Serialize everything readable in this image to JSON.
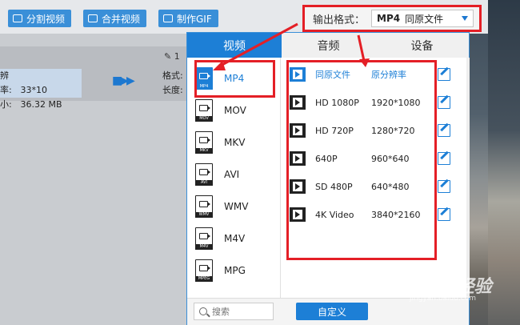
{
  "toolbar": {
    "split_label": "分割视频",
    "merge_label": "合并视频",
    "gif_label": "制作GIF"
  },
  "file_row": {
    "edit_tag": "1",
    "resolution_key": "辨率:",
    "resolution_val": "33*10",
    "size_key": "小:",
    "size_val": "36.32 MB",
    "format_key": "格式:",
    "length_key": "长度:"
  },
  "output_format": {
    "label": "输出格式：",
    "format": "MP4",
    "option": "同原文件"
  },
  "tabs": [
    {
      "label": "视频",
      "active": true
    },
    {
      "label": "音频",
      "active": false
    },
    {
      "label": "设备",
      "active": false
    }
  ],
  "formats": [
    {
      "name": "MP4",
      "tag": "MP4",
      "selected": true
    },
    {
      "name": "MOV",
      "tag": "MOV",
      "selected": false
    },
    {
      "name": "MKV",
      "tag": "MKV",
      "selected": false
    },
    {
      "name": "AVI",
      "tag": "AVI",
      "selected": false
    },
    {
      "name": "WMV",
      "tag": "WMV",
      "selected": false
    },
    {
      "name": "M4V",
      "tag": "M4V",
      "selected": false
    },
    {
      "name": "MPG",
      "tag": "MPEG",
      "selected": false
    }
  ],
  "resolutions": [
    {
      "name": "同原文件",
      "size": "原分辨率"
    },
    {
      "name": "HD 1080P",
      "size": "1920*1080"
    },
    {
      "name": "HD 720P",
      "size": "1280*720"
    },
    {
      "name": "640P",
      "size": "960*640"
    },
    {
      "name": "SD 480P",
      "size": "640*480"
    },
    {
      "name": "4K Video",
      "size": "3840*2160"
    }
  ],
  "bottom": {
    "search_placeholder": "搜索",
    "custom_label": "自定义"
  },
  "watermark": {
    "brand": "Baidu经验",
    "url": "jingyan.baidu.com"
  },
  "colors": {
    "accent": "#1d7fd6",
    "highlight": "#e41f26"
  }
}
